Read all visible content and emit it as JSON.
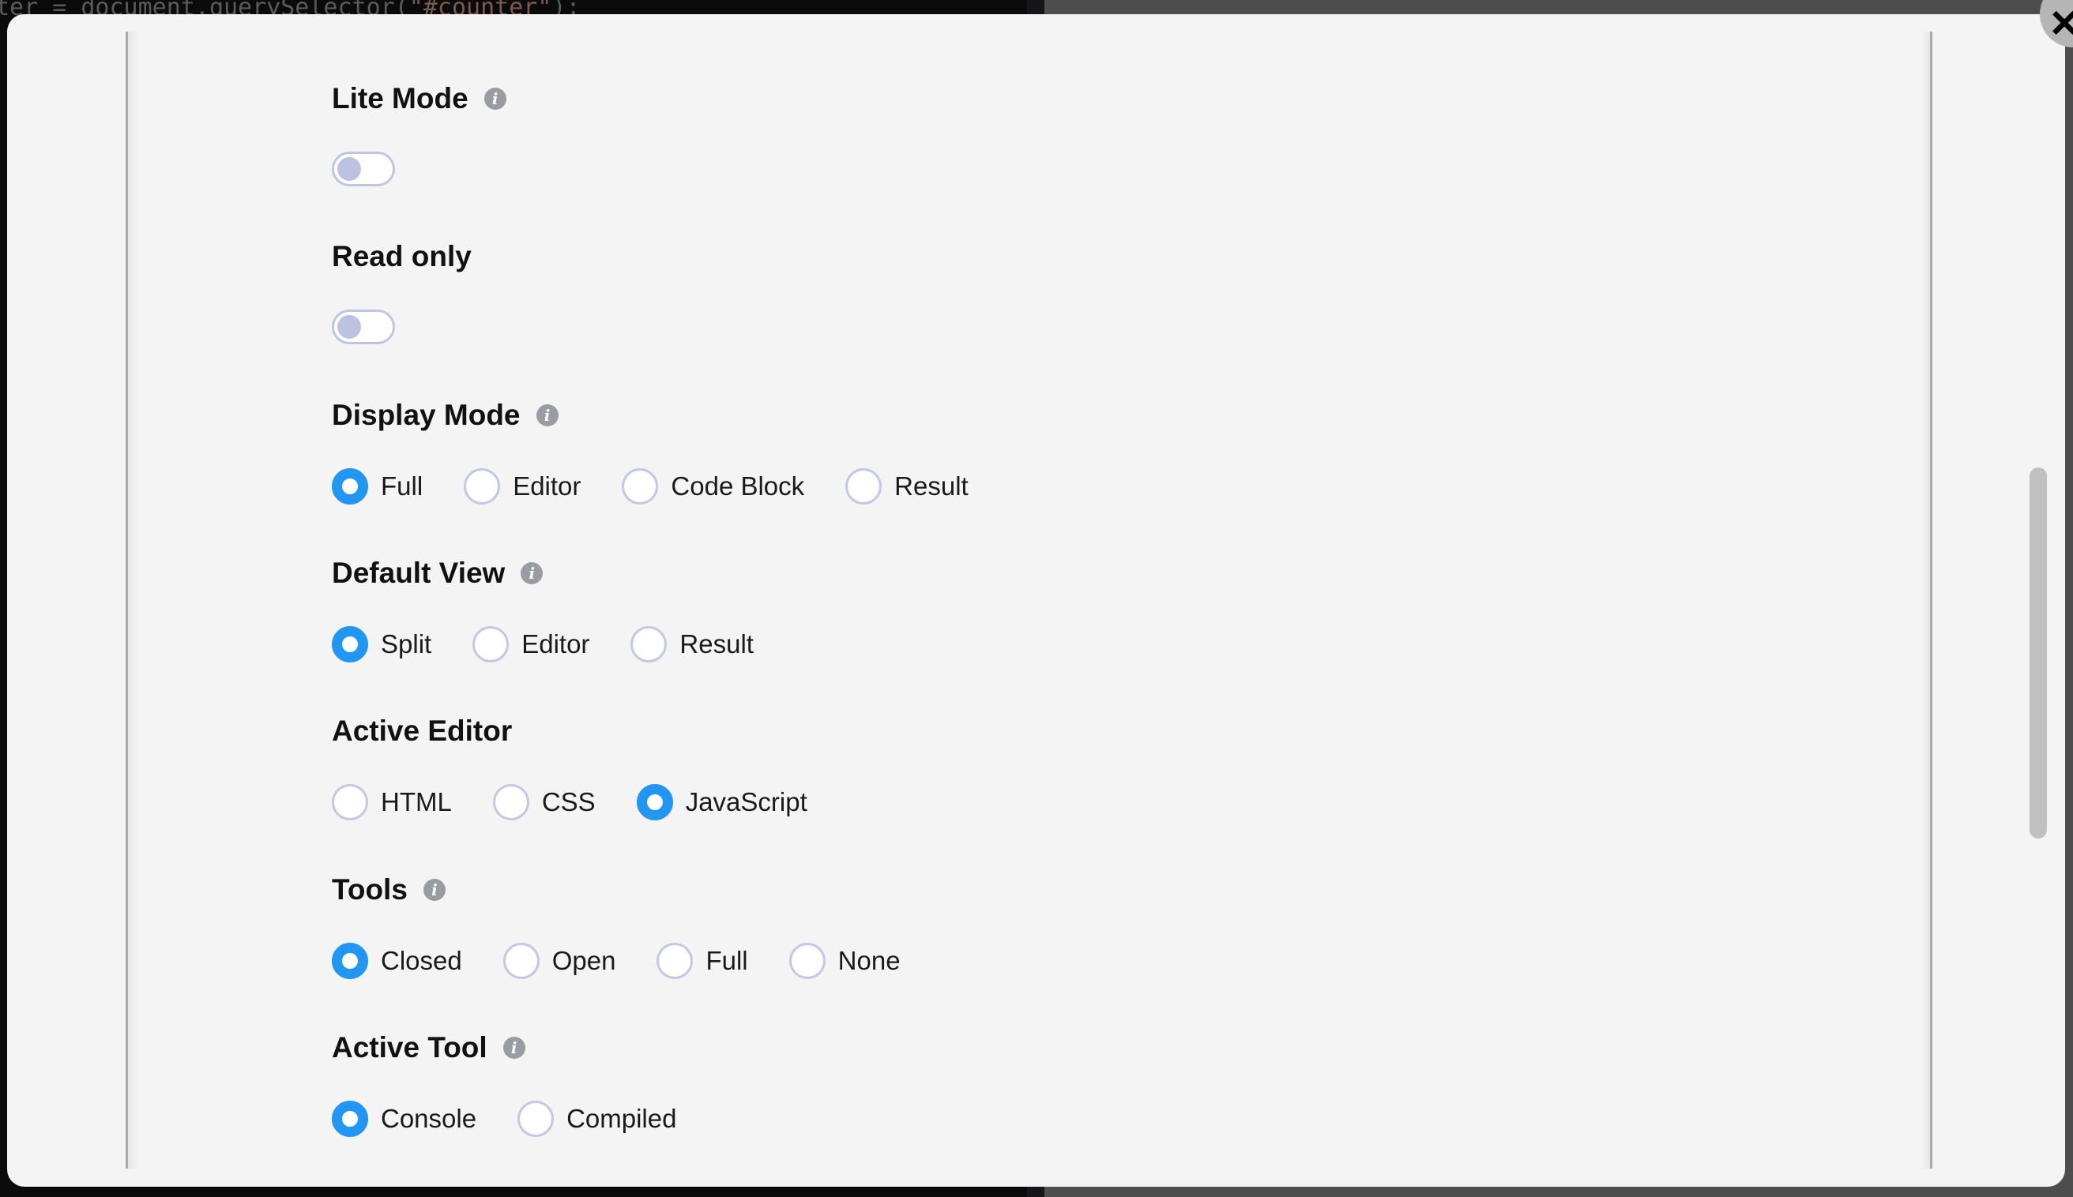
{
  "background": {
    "code_line": "ter = document.querySelector(\"#counter\");",
    "code_prefix": "ter = document.querySelector(",
    "code_string": "\"#counter\"",
    "code_suffix": ");"
  },
  "modal": {
    "close_icon": "×",
    "fields": {
      "lite_mode": {
        "label": "Lite Mode",
        "has_info": true,
        "type": "toggle",
        "value": false
      },
      "read_only": {
        "label": "Read only",
        "has_info": false,
        "type": "toggle",
        "value": false
      },
      "display_mode": {
        "label": "Display Mode",
        "has_info": true,
        "type": "radio",
        "selected": "Full",
        "options": [
          "Full",
          "Editor",
          "Code Block",
          "Result"
        ]
      },
      "default_view": {
        "label": "Default View",
        "has_info": true,
        "type": "radio",
        "selected": "Split",
        "options": [
          "Split",
          "Editor",
          "Result"
        ]
      },
      "active_editor": {
        "label": "Active Editor",
        "has_info": false,
        "type": "radio",
        "selected": "JavaScript",
        "options": [
          "HTML",
          "CSS",
          "JavaScript"
        ]
      },
      "tools": {
        "label": "Tools",
        "has_info": true,
        "type": "radio",
        "selected": "Closed",
        "options": [
          "Closed",
          "Open",
          "Full",
          "None"
        ]
      },
      "active_tool": {
        "label": "Active Tool",
        "has_info": true,
        "type": "radio",
        "selected": "Console",
        "options": [
          "Console",
          "Compiled"
        ]
      }
    },
    "info_icon": "i"
  },
  "colors": {
    "accent": "#2196f3",
    "toggle_off": "#bcc3e2",
    "modal_bg": "#f4f4f4",
    "info_icon": "#9a9ca4"
  }
}
